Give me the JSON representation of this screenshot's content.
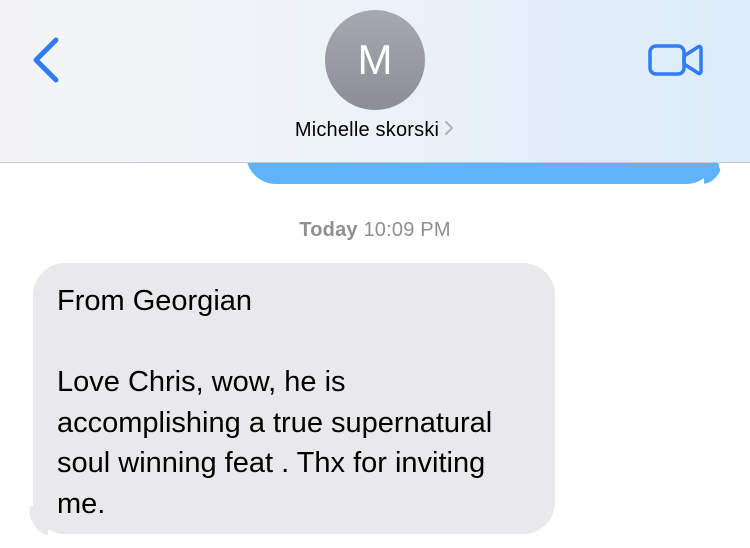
{
  "header": {
    "avatar_initial": "M",
    "contact_name": "Michelle skorski",
    "icons": {
      "back": "chevron-left-icon",
      "details": "chevron-right-icon",
      "video": "video-camera-icon"
    },
    "accent_color": "#2f7cf6"
  },
  "thread": {
    "timestamp_day": "Today",
    "timestamp_time": "10:09 PM",
    "incoming_message": {
      "text": "From Georgian\n\nLove Chris, wow, he is accomplishing a true supernatural soul winning feat . Thx for inviting me.",
      "bubble_color": "#e9e9eb"
    },
    "outgoing_bubble_color": "#5eb3fa"
  }
}
